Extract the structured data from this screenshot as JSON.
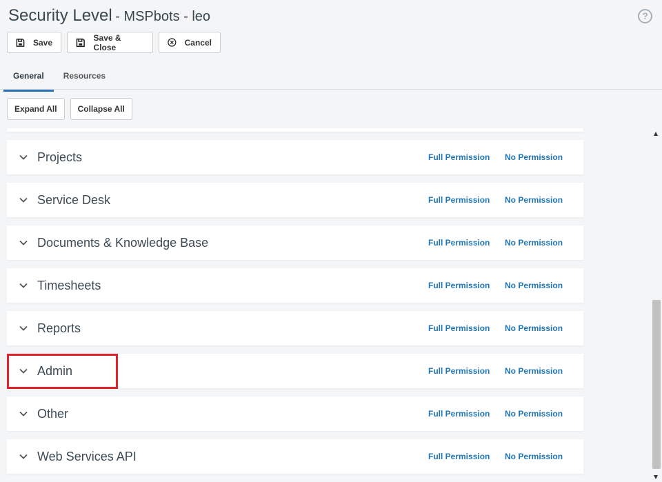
{
  "header": {
    "title": "Security Level",
    "subtitle": "- MSPbots - leo",
    "help_glyph": "?"
  },
  "toolbar": {
    "save_label": "Save",
    "save_close_label": "Save & Close",
    "cancel_label": "Cancel"
  },
  "tabs": [
    {
      "label": "General",
      "active": true
    },
    {
      "label": "Resources",
      "active": false
    }
  ],
  "controls": {
    "expand_all": "Expand All",
    "collapse_all": "Collapse All"
  },
  "sections": [
    {
      "label": "Projects",
      "full": "Full Permission",
      "none": "No Permission"
    },
    {
      "label": "Service Desk",
      "full": "Full Permission",
      "none": "No Permission"
    },
    {
      "label": "Documents & Knowledge Base",
      "full": "Full Permission",
      "none": "No Permission"
    },
    {
      "label": "Timesheets",
      "full": "Full Permission",
      "none": "No Permission"
    },
    {
      "label": "Reports",
      "full": "Full Permission",
      "none": "No Permission"
    },
    {
      "label": "Admin",
      "full": "Full Permission",
      "none": "No Permission"
    },
    {
      "label": "Other",
      "full": "Full Permission",
      "none": "No Permission"
    },
    {
      "label": "Web Services API",
      "full": "Full Permission",
      "none": "No Permission"
    }
  ],
  "icons": {
    "save": "floppy-disk-icon",
    "save_close": "floppy-disk-icon",
    "cancel": "circle-x-icon",
    "help": "question-circle-icon",
    "chevron": "chevron-down-icon"
  },
  "colors": {
    "link": "#1f75b8",
    "tab_accent": "#2a72b8",
    "highlight": "#e0222b"
  }
}
